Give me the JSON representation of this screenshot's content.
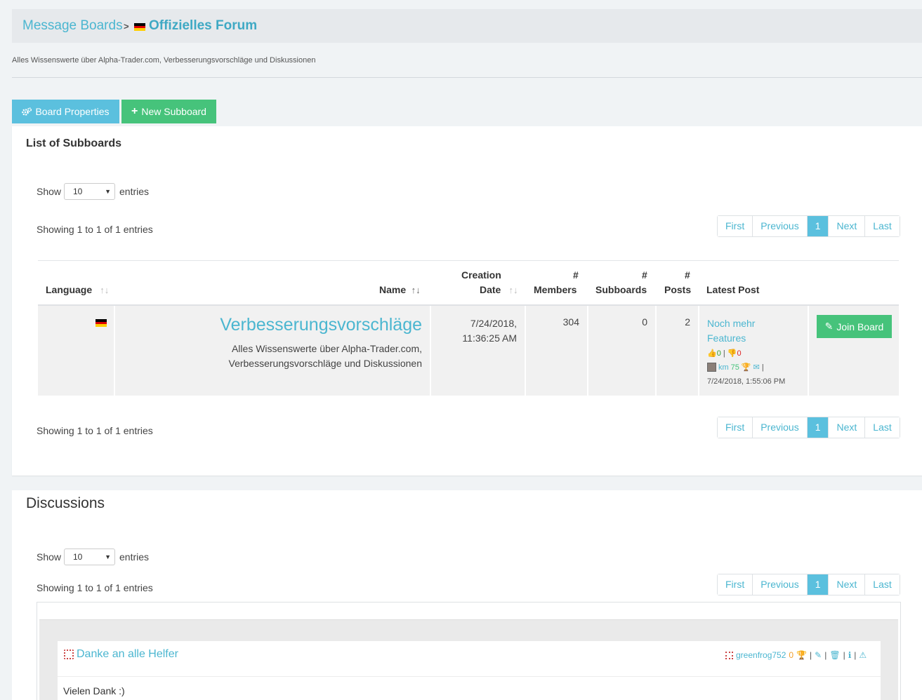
{
  "breadcrumb": {
    "root": "Message Boards",
    "separator": ">",
    "current": "Offizielles Forum"
  },
  "board_description": "Alles Wissenswerte über Alpha-Trader.com, Verbesserungsvorschläge und Diskussionen",
  "buttons": {
    "board_properties": "Board Properties",
    "new_subboard": "New Subboard"
  },
  "subboards": {
    "title": "List of Subboards",
    "show_label": "Show",
    "entries_label": "entries",
    "page_size": "10",
    "info_top": "Showing 1 to 1 of 1 entries",
    "info_bottom": "Showing 1 to 1 of 1 entries",
    "pager": {
      "first": "First",
      "previous": "Previous",
      "page": "1",
      "next": "Next",
      "last": "Last"
    },
    "columns": {
      "language": "Language",
      "name": "Name",
      "creation_line1": "Creation",
      "creation_line2": "Date",
      "members_hash": "#",
      "members": "Members",
      "subboards_hash": "#",
      "subboards": "Subboards",
      "posts_hash": "#",
      "posts": "Posts",
      "latest_post": "Latest Post"
    },
    "row": {
      "name": "Verbesserungsvorschläge",
      "description_line1": "Alles Wissenswerte über Alpha-Trader.com,",
      "description_line2": "Verbesserungsvorschläge und Diskussionen",
      "date_line1": "7/24/2018,",
      "date_line2": "11:36:25 AM",
      "members": "304",
      "subboards": "0",
      "posts": "2",
      "latest_post_line1": "Noch mehr",
      "latest_post_line2": "Features",
      "likes": "0",
      "dislikes": "0",
      "author": "km",
      "author_score": "75",
      "separator": "|",
      "latest_post_date": "7/24/2018, 1:55:06 PM",
      "join_label": "Join Board"
    }
  },
  "discussions": {
    "title": "Discussions",
    "show_label": "Show",
    "entries_label": "entries",
    "page_size": "10",
    "info": "Showing 1 to 1 of 1 entries",
    "pager": {
      "first": "First",
      "previous": "Previous",
      "page": "1",
      "next": "Next",
      "last": "Last"
    },
    "item": {
      "title": "Danke an alle Helfer",
      "author": "greenfrog752",
      "author_score": "0",
      "separator": "|",
      "body": "Vielen Dank :)"
    }
  },
  "colors": {
    "accent": "#4bb6d0",
    "info_button": "#5bc0de",
    "success_button": "#46c37b",
    "like": "#2e9e2e",
    "dislike": "#dd2222"
  }
}
